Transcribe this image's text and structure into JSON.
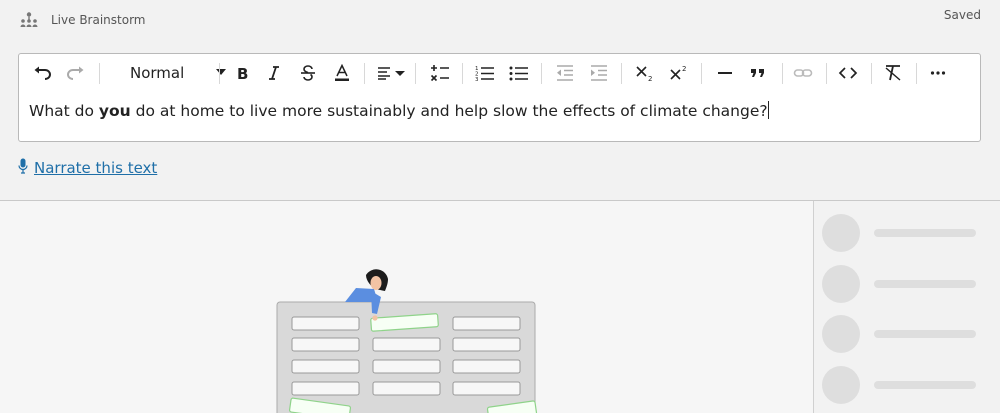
{
  "app": {
    "title": "Live Brainstorm",
    "status": "Saved"
  },
  "toolbar": {
    "style_select": "Normal",
    "buttons": [
      "undo",
      "redo",
      "bold",
      "italic",
      "strikethrough",
      "font-color",
      "align",
      "checklist",
      "numbered-list",
      "bulleted-list",
      "outdent",
      "indent",
      "subscript",
      "superscript",
      "horizontal-line",
      "blockquote",
      "link",
      "code",
      "clear-formatting",
      "more"
    ]
  },
  "editor": {
    "before": "What do ",
    "bold": "you",
    "after": " do at home to live more sustainably and help slow the effects of climate change?"
  },
  "narrate": {
    "label": "Narrate this text"
  },
  "colors": {
    "link": "#1f6fa8",
    "accent_green": "#8fd38a",
    "figure_blue": "#5b8ee0"
  }
}
